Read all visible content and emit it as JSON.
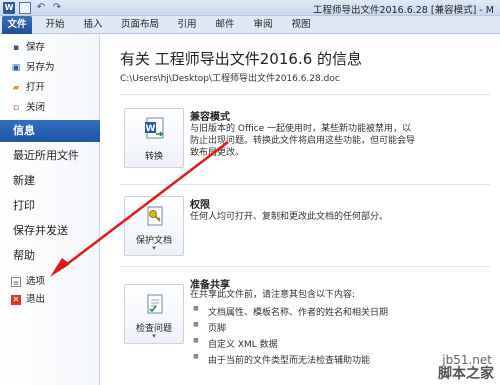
{
  "window": {
    "title": "工程师导出文件2016.6.28 [兼容模式] - M"
  },
  "ribbon": {
    "tabs": [
      "文件",
      "开始",
      "插入",
      "页面布局",
      "引用",
      "邮件",
      "审阅",
      "视图"
    ]
  },
  "nav": {
    "small_top": [
      {
        "label": "保存",
        "icon": "save-icon"
      },
      {
        "label": "另存为",
        "icon": "save-as-icon"
      },
      {
        "label": "打开",
        "icon": "open-folder-icon"
      },
      {
        "label": "关闭",
        "icon": "close-doc-icon"
      }
    ],
    "big": [
      "信息",
      "最近所用文件",
      "新建",
      "打印",
      "保存并发送",
      "帮助"
    ],
    "small_bottom": [
      {
        "label": "选项",
        "icon": "options-icon"
      },
      {
        "label": "退出",
        "icon": "exit-icon"
      }
    ],
    "active": "信息"
  },
  "info": {
    "heading": "有关 工程师导出文件2016.6 的信息",
    "path": "C:\\Users\\hj\\Desktop\\工程师导出文件2016.6.28.doc"
  },
  "sections": {
    "compat": {
      "button": "转换",
      "title": "兼容模式",
      "desc": "与旧版本的 Office 一起使用时，某些新功能被禁用，以防止出现问题。转换此文件将启用这些功能，但可能会导致布局更改。"
    },
    "permissions": {
      "button": "保护文档",
      "title": "权限",
      "desc": "任何人均可打开、复制和更改此文档的任何部分。"
    },
    "prepare": {
      "button": "检查问题",
      "title": "准备共享",
      "desc": "在共享此文件前，请注意其包含以下内容:",
      "bullets": [
        "文档属性、模板名称、作者的姓名和相关日期",
        "页脚",
        "自定义 XML 数据",
        "由于当前的文件类型而无法检查辅助功能"
      ]
    }
  },
  "watermark": {
    "site": "jb51.net",
    "name": "脚本之家"
  },
  "colors": {
    "accent": "#1e56a5",
    "arrow": "#e01818"
  }
}
